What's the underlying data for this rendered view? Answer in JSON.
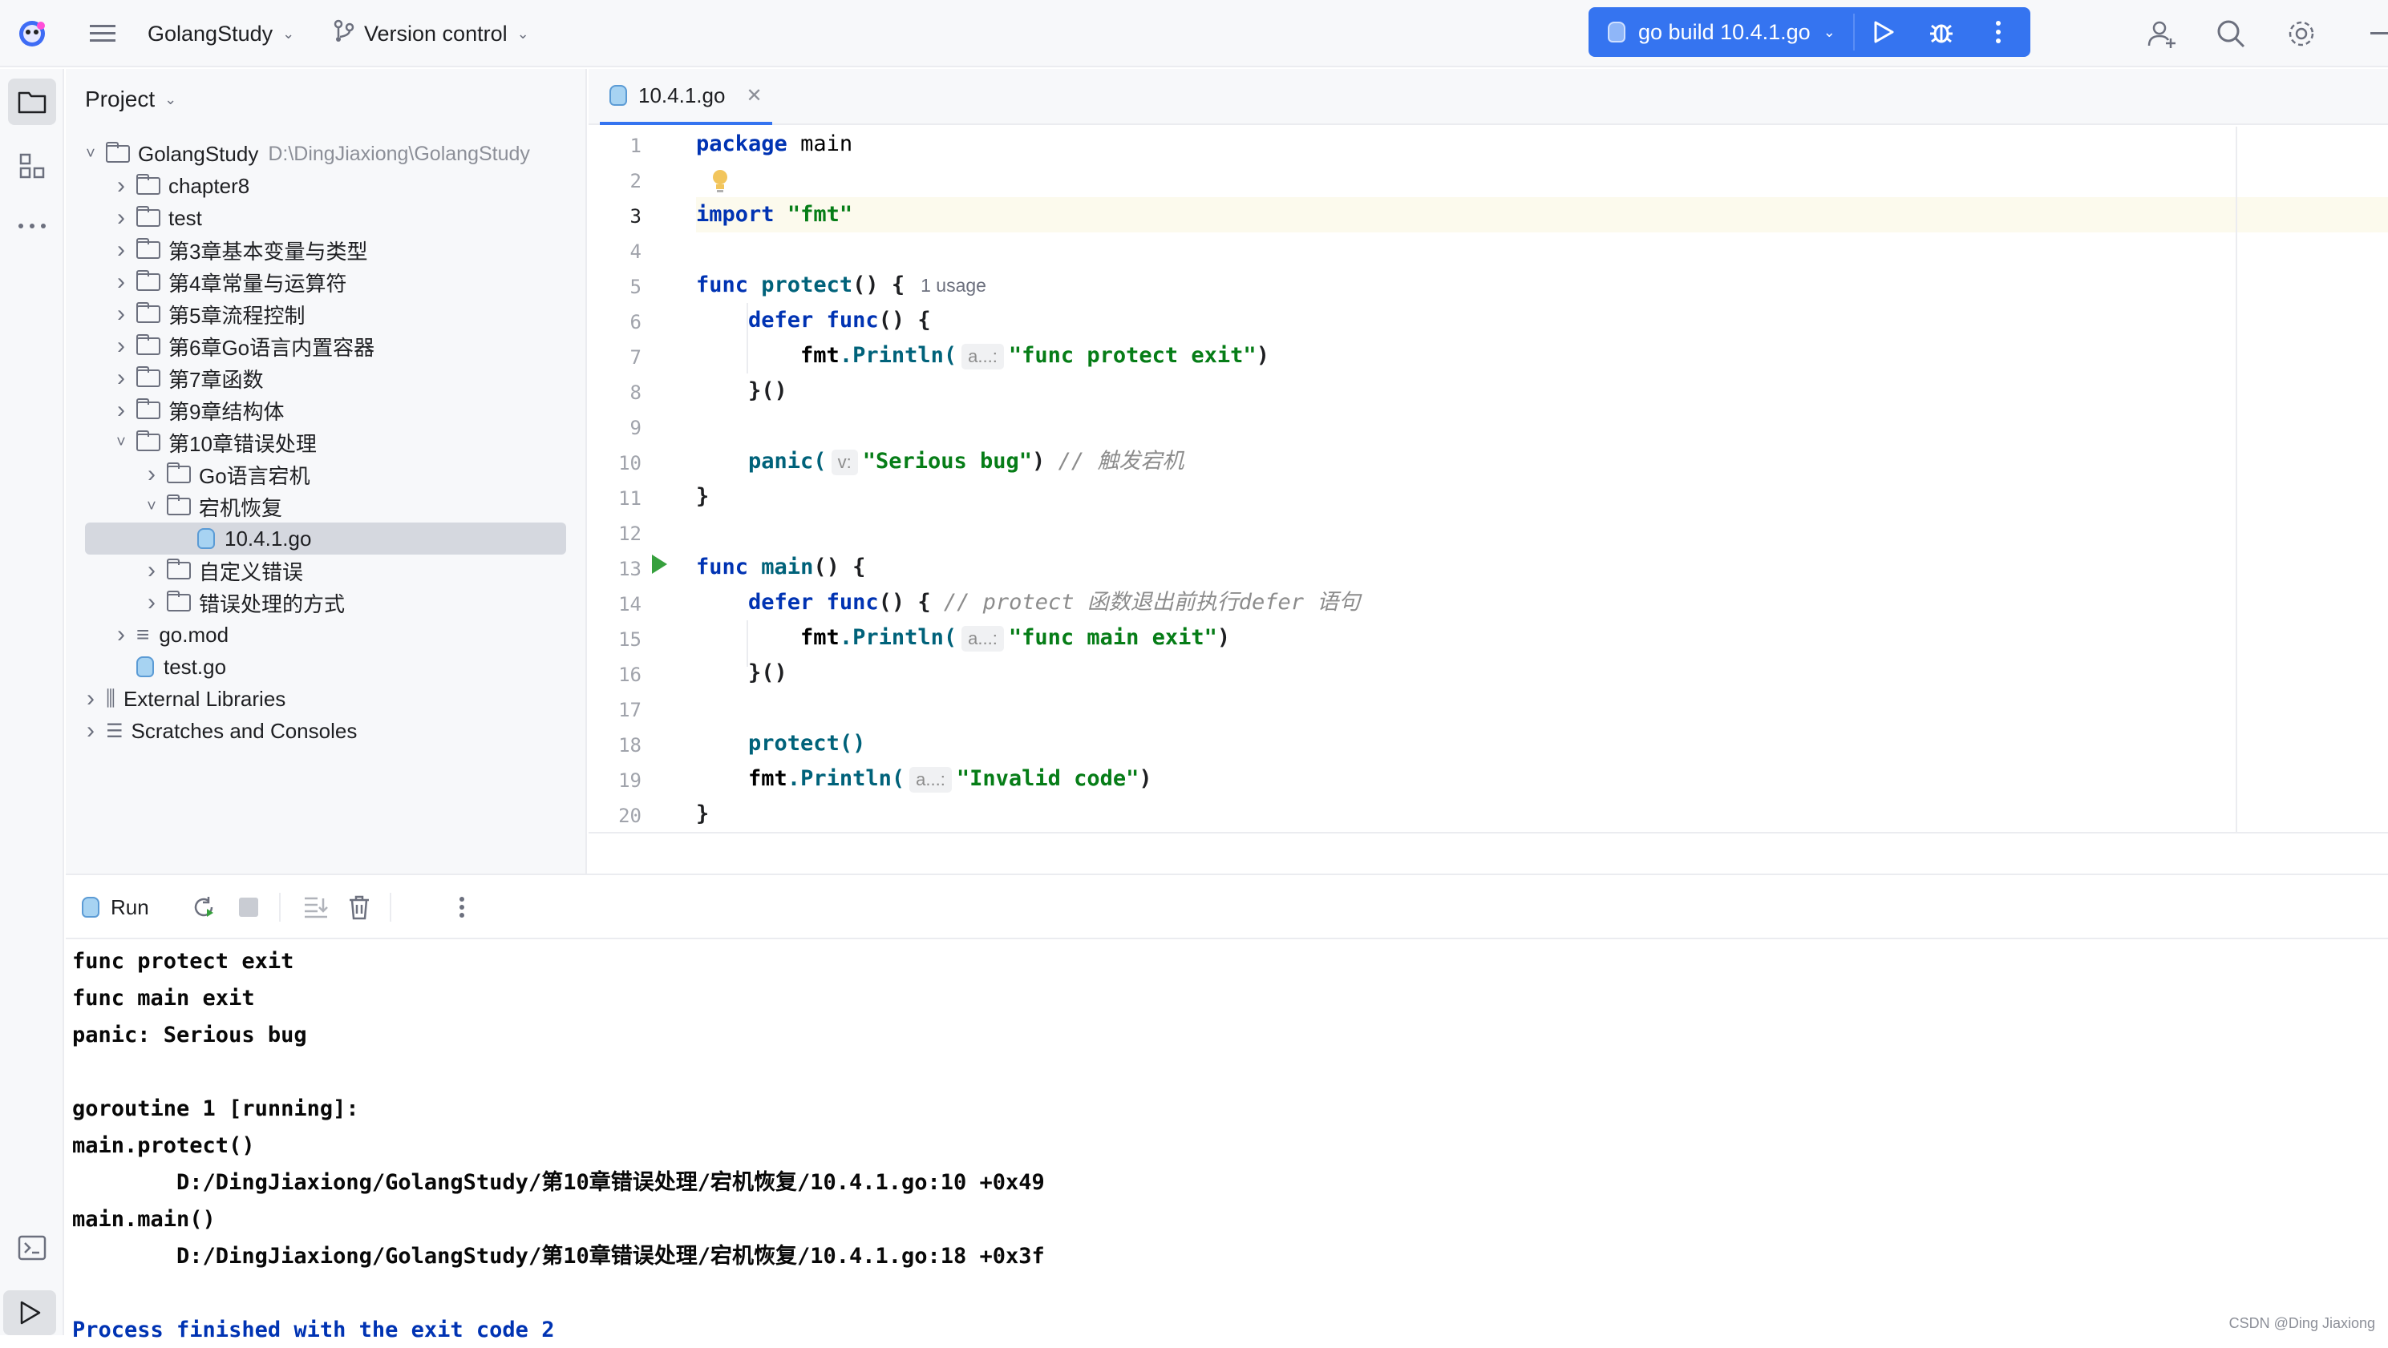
{
  "header": {
    "project_name": "GolangStudy",
    "vcs_label": "Version control",
    "run_config": "go build 10.4.1.go"
  },
  "project_panel": {
    "title": "Project",
    "tree": [
      {
        "label": "GolangStudy",
        "path": "D:\\DingJiaxiong\\GolangStudy",
        "depth": 0,
        "type": "folder",
        "expanded": true
      },
      {
        "label": "chapter8",
        "depth": 1,
        "type": "folder",
        "expanded": false
      },
      {
        "label": "test",
        "depth": 1,
        "type": "folder",
        "expanded": false
      },
      {
        "label": "第3章基本变量与类型",
        "depth": 1,
        "type": "folder",
        "expanded": false
      },
      {
        "label": "第4章常量与运算符",
        "depth": 1,
        "type": "folder",
        "expanded": false
      },
      {
        "label": "第5章流程控制",
        "depth": 1,
        "type": "folder",
        "expanded": false
      },
      {
        "label": "第6章Go语言内置容器",
        "depth": 1,
        "type": "folder",
        "expanded": false
      },
      {
        "label": "第7章函数",
        "depth": 1,
        "type": "folder",
        "expanded": false
      },
      {
        "label": "第9章结构体",
        "depth": 1,
        "type": "folder",
        "expanded": false
      },
      {
        "label": "第10章错误处理",
        "depth": 1,
        "type": "folder",
        "expanded": true
      },
      {
        "label": "Go语言宕机",
        "depth": 2,
        "type": "folder",
        "expanded": false
      },
      {
        "label": "宕机恢复",
        "depth": 2,
        "type": "folder",
        "expanded": true
      },
      {
        "label": "10.4.1.go",
        "depth": 3,
        "type": "gofile",
        "selected": true
      },
      {
        "label": "自定义错误",
        "depth": 2,
        "type": "folder",
        "expanded": false
      },
      {
        "label": "错误处理的方式",
        "depth": 2,
        "type": "folder",
        "expanded": false
      },
      {
        "label": "go.mod",
        "depth": 1,
        "type": "mod",
        "expanded": false
      },
      {
        "label": "test.go",
        "depth": 1,
        "type": "gofile"
      },
      {
        "label": "External Libraries",
        "depth": 0,
        "type": "lib",
        "expanded": false
      },
      {
        "label": "Scratches and Consoles",
        "depth": 0,
        "type": "scratch",
        "expanded": false
      }
    ]
  },
  "editor": {
    "tab_label": "10.4.1.go",
    "line_numbers": [
      "1",
      "2",
      "3",
      "4",
      "5",
      "6",
      "7",
      "8",
      "9",
      "10",
      "11",
      "12",
      "13",
      "14",
      "15",
      "16",
      "17",
      "18",
      "19",
      "20"
    ],
    "code": {
      "l1": {
        "kw": "package",
        "name": "main"
      },
      "l3": {
        "kw": "import",
        "str": "\"fmt\""
      },
      "l5": {
        "kw": "func",
        "name": "protect",
        "rest": "() {",
        "usage": "1 usage"
      },
      "l6": {
        "kw": "defer",
        "kw2": "func",
        "rest": "() {"
      },
      "l7": {
        "pkg": "fmt",
        "fn": ".Println(",
        "hint": "a...:",
        "str": "\"func protect exit\"",
        "close": ")"
      },
      "l8": {
        "text": "}()"
      },
      "l10": {
        "fn": "panic(",
        "hint": "v:",
        "str": "\"Serious bug\"",
        "close": ")",
        "comment": "// 触发宕机"
      },
      "l11": {
        "text": "}"
      },
      "l13": {
        "kw": "func",
        "name": "main",
        "rest": "() {"
      },
      "l14": {
        "kw": "defer",
        "kw2": "func",
        "rest": "() {",
        "comment": "// protect 函数退出前执行defer 语句"
      },
      "l15": {
        "pkg": "fmt",
        "fn": ".Println(",
        "hint": "a...:",
        "str": "\"func main exit\"",
        "close": ")"
      },
      "l16": {
        "text": "}()"
      },
      "l18": {
        "fn": "protect()"
      },
      "l19": {
        "pkg": "fmt",
        "fn": ".Println(",
        "hint": "a...:",
        "str": "\"Invalid code\"",
        "close": ")"
      },
      "l20": {
        "text": "}"
      }
    }
  },
  "run_panel": {
    "tab_label": "Run",
    "output": [
      "func protect exit",
      "func main exit",
      "panic: Serious bug",
      "",
      "goroutine 1 [running]:",
      "main.protect()",
      "        D:/DingJiaxiong/GolangStudy/第10章错误处理/宕机恢复/10.4.1.go:10 +0x49",
      "main.main()",
      "        D:/DingJiaxiong/GolangStudy/第10章错误处理/宕机恢复/10.4.1.go:18 +0x3f",
      "",
      "Process finished with the exit code 2"
    ]
  },
  "watermark": "CSDN @Ding Jiaxiong",
  "colors": {
    "accent": "#3574f0",
    "keyword": "#0033b3",
    "string": "#067d17",
    "function": "#00627a",
    "comment": "#8c8c8c",
    "run_green": "#36a03d"
  },
  "icons": [
    "app-logo-icon",
    "hamburger-menu-icon",
    "branch-icon",
    "run-icon",
    "debug-icon",
    "more-vertical-icon",
    "add-user-icon",
    "search-icon",
    "settings-gear-icon",
    "folder-icon",
    "structure-icon",
    "more-horizontal-icon",
    "terminal-icon",
    "run-tool-icon",
    "go-file-icon",
    "close-icon",
    "lightbulb-icon",
    "run-gutter-icon",
    "rerun-icon",
    "stop-icon",
    "scroll-to-end-icon",
    "trash-icon"
  ]
}
